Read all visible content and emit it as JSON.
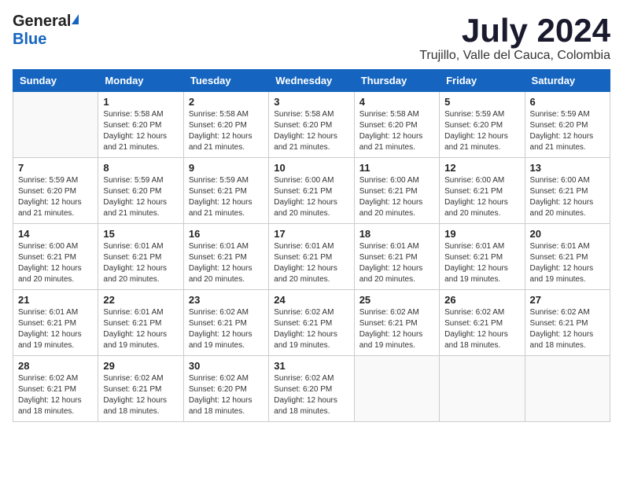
{
  "header": {
    "logo_general": "General",
    "logo_blue": "Blue",
    "month_year": "July 2024",
    "location": "Trujillo, Valle del Cauca, Colombia"
  },
  "days_of_week": [
    "Sunday",
    "Monday",
    "Tuesday",
    "Wednesday",
    "Thursday",
    "Friday",
    "Saturday"
  ],
  "weeks": [
    [
      {
        "day": "",
        "info": ""
      },
      {
        "day": "1",
        "info": "Sunrise: 5:58 AM\nSunset: 6:20 PM\nDaylight: 12 hours\nand 21 minutes."
      },
      {
        "day": "2",
        "info": "Sunrise: 5:58 AM\nSunset: 6:20 PM\nDaylight: 12 hours\nand 21 minutes."
      },
      {
        "day": "3",
        "info": "Sunrise: 5:58 AM\nSunset: 6:20 PM\nDaylight: 12 hours\nand 21 minutes."
      },
      {
        "day": "4",
        "info": "Sunrise: 5:58 AM\nSunset: 6:20 PM\nDaylight: 12 hours\nand 21 minutes."
      },
      {
        "day": "5",
        "info": "Sunrise: 5:59 AM\nSunset: 6:20 PM\nDaylight: 12 hours\nand 21 minutes."
      },
      {
        "day": "6",
        "info": "Sunrise: 5:59 AM\nSunset: 6:20 PM\nDaylight: 12 hours\nand 21 minutes."
      }
    ],
    [
      {
        "day": "7",
        "info": ""
      },
      {
        "day": "8",
        "info": "Sunrise: 5:59 AM\nSunset: 6:20 PM\nDaylight: 12 hours\nand 21 minutes."
      },
      {
        "day": "9",
        "info": "Sunrise: 5:59 AM\nSunset: 6:21 PM\nDaylight: 12 hours\nand 21 minutes."
      },
      {
        "day": "10",
        "info": "Sunrise: 6:00 AM\nSunset: 6:21 PM\nDaylight: 12 hours\nand 20 minutes."
      },
      {
        "day": "11",
        "info": "Sunrise: 6:00 AM\nSunset: 6:21 PM\nDaylight: 12 hours\nand 20 minutes."
      },
      {
        "day": "12",
        "info": "Sunrise: 6:00 AM\nSunset: 6:21 PM\nDaylight: 12 hours\nand 20 minutes."
      },
      {
        "day": "13",
        "info": "Sunrise: 6:00 AM\nSunset: 6:21 PM\nDaylight: 12 hours\nand 20 minutes."
      }
    ],
    [
      {
        "day": "14",
        "info": ""
      },
      {
        "day": "15",
        "info": "Sunrise: 6:01 AM\nSunset: 6:21 PM\nDaylight: 12 hours\nand 20 minutes."
      },
      {
        "day": "16",
        "info": "Sunrise: 6:01 AM\nSunset: 6:21 PM\nDaylight: 12 hours\nand 20 minutes."
      },
      {
        "day": "17",
        "info": "Sunrise: 6:01 AM\nSunset: 6:21 PM\nDaylight: 12 hours\nand 20 minutes."
      },
      {
        "day": "18",
        "info": "Sunrise: 6:01 AM\nSunset: 6:21 PM\nDaylight: 12 hours\nand 20 minutes."
      },
      {
        "day": "19",
        "info": "Sunrise: 6:01 AM\nSunset: 6:21 PM\nDaylight: 12 hours\nand 19 minutes."
      },
      {
        "day": "20",
        "info": "Sunrise: 6:01 AM\nSunset: 6:21 PM\nDaylight: 12 hours\nand 19 minutes."
      }
    ],
    [
      {
        "day": "21",
        "info": ""
      },
      {
        "day": "22",
        "info": "Sunrise: 6:01 AM\nSunset: 6:21 PM\nDaylight: 12 hours\nand 19 minutes."
      },
      {
        "day": "23",
        "info": "Sunrise: 6:02 AM\nSunset: 6:21 PM\nDaylight: 12 hours\nand 19 minutes."
      },
      {
        "day": "24",
        "info": "Sunrise: 6:02 AM\nSunset: 6:21 PM\nDaylight: 12 hours\nand 19 minutes."
      },
      {
        "day": "25",
        "info": "Sunrise: 6:02 AM\nSunset: 6:21 PM\nDaylight: 12 hours\nand 19 minutes."
      },
      {
        "day": "26",
        "info": "Sunrise: 6:02 AM\nSunset: 6:21 PM\nDaylight: 12 hours\nand 18 minutes."
      },
      {
        "day": "27",
        "info": "Sunrise: 6:02 AM\nSunset: 6:21 PM\nDaylight: 12 hours\nand 18 minutes."
      }
    ],
    [
      {
        "day": "28",
        "info": "Sunrise: 6:02 AM\nSunset: 6:21 PM\nDaylight: 12 hours\nand 18 minutes."
      },
      {
        "day": "29",
        "info": "Sunrise: 6:02 AM\nSunset: 6:21 PM\nDaylight: 12 hours\nand 18 minutes."
      },
      {
        "day": "30",
        "info": "Sunrise: 6:02 AM\nSunset: 6:20 PM\nDaylight: 12 hours\nand 18 minutes."
      },
      {
        "day": "31",
        "info": "Sunrise: 6:02 AM\nSunset: 6:20 PM\nDaylight: 12 hours\nand 18 minutes."
      },
      {
        "day": "",
        "info": ""
      },
      {
        "day": "",
        "info": ""
      },
      {
        "day": "",
        "info": ""
      }
    ]
  ],
  "week7_info": {
    "7": "Sunrise: 5:59 AM\nSunset: 6:20 PM\nDaylight: 12 hours\nand 21 minutes.",
    "14": "Sunrise: 6:00 AM\nSunset: 6:21 PM\nDaylight: 12 hours\nand 20 minutes.",
    "21": "Sunrise: 6:01 AM\nSunset: 6:21 PM\nDaylight: 12 hours\nand 19 minutes."
  }
}
